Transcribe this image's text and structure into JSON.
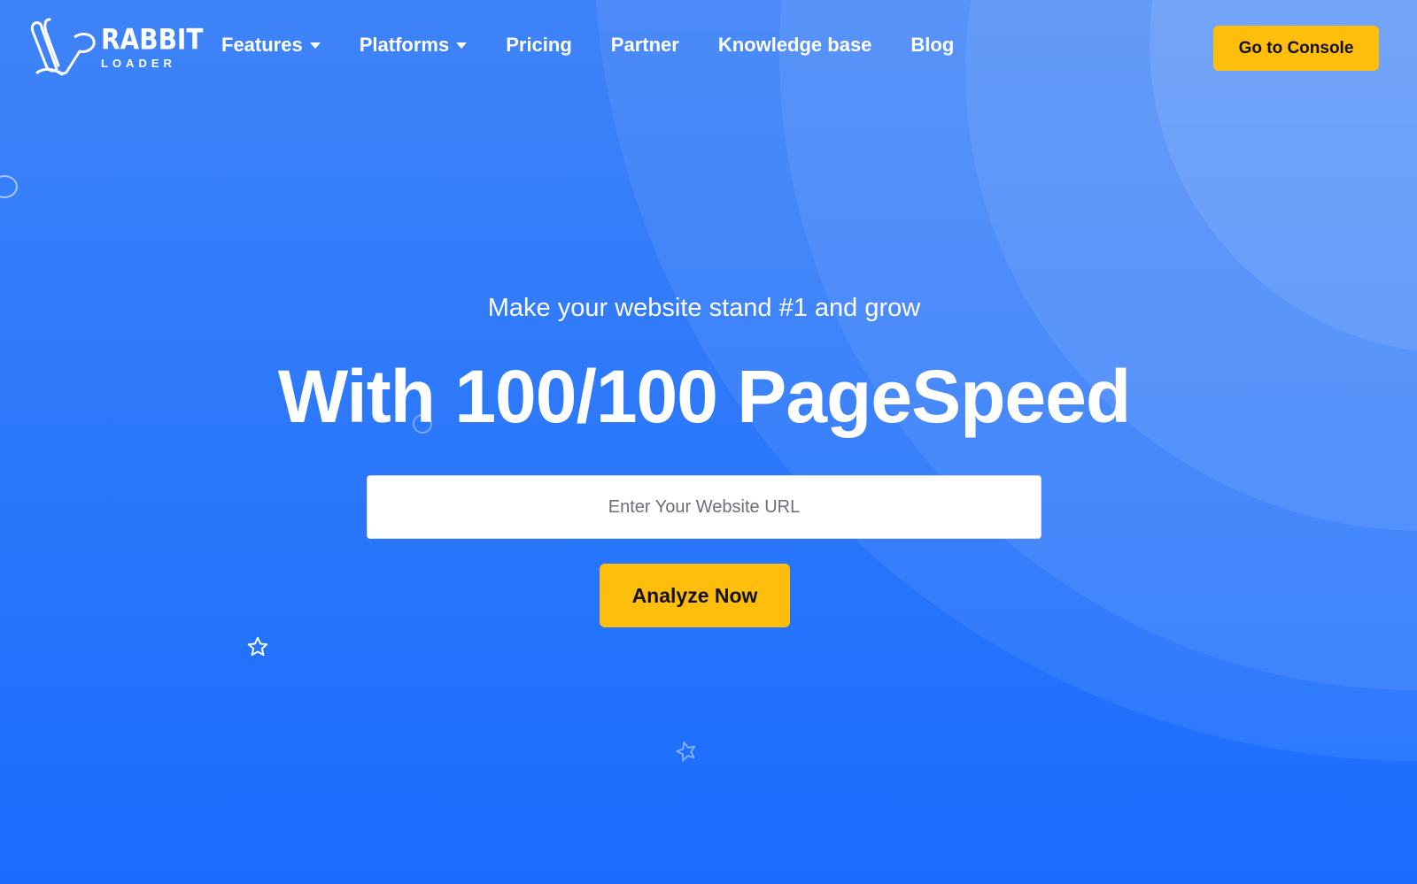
{
  "brand": {
    "name_top": "RABBIT",
    "name_bottom": "LOADER",
    "logo_icon": "rabbit-ears-icon"
  },
  "nav": {
    "items": [
      {
        "label": "Features",
        "has_dropdown": true
      },
      {
        "label": "Platforms",
        "has_dropdown": true
      },
      {
        "label": "Pricing",
        "has_dropdown": false
      },
      {
        "label": "Partner",
        "has_dropdown": false
      },
      {
        "label": "Knowledge base",
        "has_dropdown": false
      },
      {
        "label": "Blog",
        "has_dropdown": false
      }
    ],
    "console_label": "Go to Console"
  },
  "hero": {
    "subtitle": "Make your website stand #1 and grow",
    "title": "With 100/100 PageSpeed",
    "url_placeholder": "Enter Your Website URL",
    "url_value": "",
    "cta_label": "Analyze Now"
  },
  "colors": {
    "background_top": "#3f83f8",
    "background_bottom": "#1a6cff",
    "accent": "#ffbe0b",
    "text": "#ffffff"
  }
}
